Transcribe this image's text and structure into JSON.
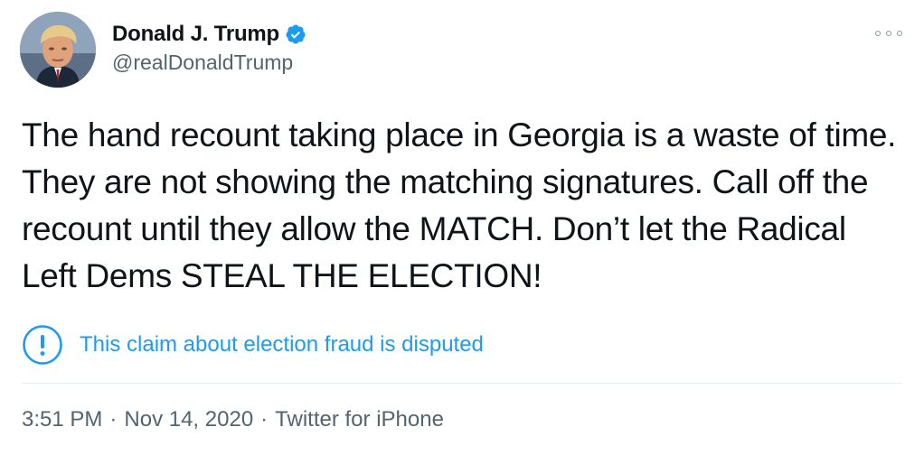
{
  "author": {
    "display_name": "Donald J. Trump",
    "handle": "@realDonaldTrump",
    "verified": true,
    "avatar_icon": "profile-photo",
    "verified_icon": "verified-badge-icon"
  },
  "tweet": {
    "text": "The hand recount taking place in Georgia is a waste of time. They are not showing the matching signatures. Call off the recount until they allow the MATCH. Don’t let the Radical Left Dems STEAL THE ELECTION!"
  },
  "notice": {
    "icon": "exclamation-circle-icon",
    "text": "This claim about election fraud is disputed"
  },
  "meta": {
    "time": "3:51 PM",
    "separator": "·",
    "date": "Nov 14, 2020",
    "source": "Twitter for iPhone"
  },
  "more_menu_icon": "more-options-icon",
  "colors": {
    "text": "#0f1419",
    "secondary": "#536471",
    "accent": "#1d9bf0",
    "verified": "#1d9bf0",
    "divider": "#e6ecf0"
  }
}
